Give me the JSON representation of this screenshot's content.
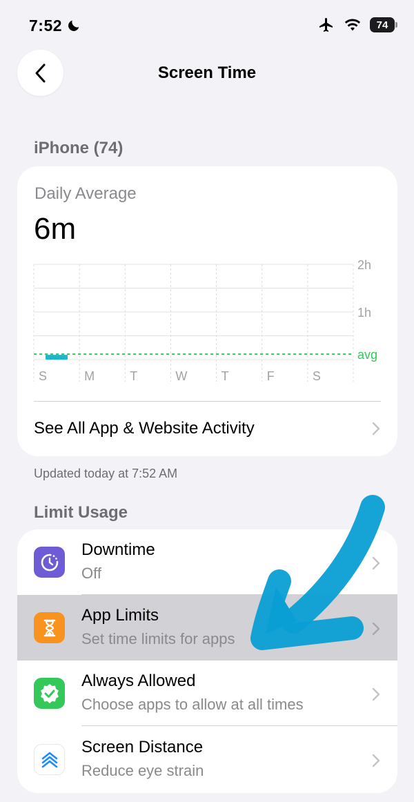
{
  "status_bar": {
    "time": "7:52",
    "battery": "74",
    "icons": [
      "moon-icon",
      "airplane-icon",
      "wifi-icon",
      "battery-icon"
    ]
  },
  "nav": {
    "title": "Screen Time",
    "back_icon": "chevron-left-icon"
  },
  "device_header": "iPhone (74)",
  "summary": {
    "label": "Daily Average",
    "value": "6m"
  },
  "chart_data": {
    "type": "bar",
    "categories": [
      "S",
      "M",
      "T",
      "W",
      "T",
      "F",
      "S"
    ],
    "values": [
      6,
      0,
      0,
      0,
      0,
      0,
      0
    ],
    "y_ticks": [
      "2h",
      "1h"
    ],
    "ylim": [
      0,
      120
    ],
    "average_label": "avg",
    "average_value": 6,
    "colors": {
      "bar": "#1fb6c9",
      "average": "#34c759"
    }
  },
  "activity_link": "See All App & Website Activity",
  "updated": "Updated today at 7:52 AM",
  "limit_header": "Limit Usage",
  "limit_rows": [
    {
      "title": "Downtime",
      "subtitle": "Off",
      "icon": "downtime-icon",
      "color": "#6e5bd6"
    },
    {
      "title": "App Limits",
      "subtitle": "Set time limits for apps",
      "icon": "hourglass-icon",
      "color": "#f7931e"
    },
    {
      "title": "Always Allowed",
      "subtitle": "Choose apps to allow at all times",
      "icon": "checkmark-badge-icon",
      "color": "#34c759"
    },
    {
      "title": "Screen Distance",
      "subtitle": "Reduce eye strain",
      "icon": "screen-distance-icon",
      "color": "#1a8cff"
    }
  ],
  "annotation": {
    "icon": "arrow-annotation-icon",
    "color": "#0a9fd4"
  }
}
